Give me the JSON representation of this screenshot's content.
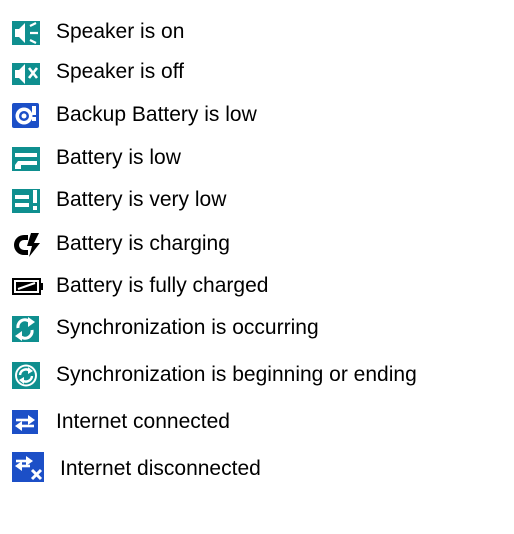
{
  "legend": [
    {
      "icon": "speaker-on-icon",
      "label": "Speaker is on"
    },
    {
      "icon": "speaker-off-icon",
      "label": "Speaker is off"
    },
    {
      "icon": "backup-battery-low-icon",
      "label": "Backup Battery is low"
    },
    {
      "icon": "battery-low-icon",
      "label": "Battery is low"
    },
    {
      "icon": "battery-very-low-icon",
      "label": "Battery is very low"
    },
    {
      "icon": "battery-charging-icon",
      "label": "Battery is charging"
    },
    {
      "icon": "battery-full-icon",
      "label": "Battery is fully charged"
    },
    {
      "icon": "sync-occurring-icon",
      "label": "Synchronization is occurring"
    },
    {
      "icon": "sync-begin-end-icon",
      "label": "Synchronization is beginning or ending"
    },
    {
      "icon": "internet-connected-icon",
      "label": "Internet connected"
    },
    {
      "icon": "internet-disconnected-icon",
      "label": "Internet disconnected"
    }
  ],
  "colors": {
    "teal": "#0f8f8f",
    "teal_dark": "#0a6b6b",
    "blue": "#1c4fc7",
    "white": "#ffffff",
    "black": "#000000"
  }
}
